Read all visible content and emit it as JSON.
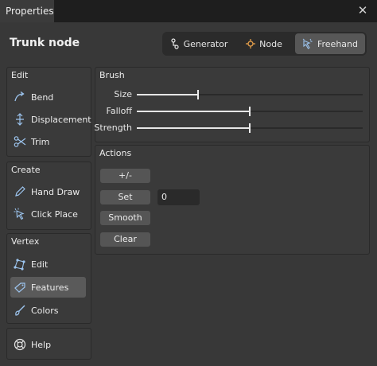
{
  "window": {
    "tab_title": "Properties",
    "close_label": "✕"
  },
  "header": {
    "title": "Trunk node"
  },
  "modes": [
    {
      "label": "Generator",
      "icon": "generator-icon",
      "active": false
    },
    {
      "label": "Node",
      "icon": "node-icon",
      "active": false
    },
    {
      "label": "Freehand",
      "icon": "freehand-icon",
      "active": true
    }
  ],
  "sidebar": {
    "edit": {
      "title": "Edit",
      "items": [
        {
          "label": "Bend",
          "icon": "bend-icon"
        },
        {
          "label": "Displacement",
          "icon": "displacement-icon"
        },
        {
          "label": "Trim",
          "icon": "scissors-icon"
        }
      ]
    },
    "create": {
      "title": "Create",
      "items": [
        {
          "label": "Hand Draw",
          "icon": "pencil-icon"
        },
        {
          "label": "Click Place",
          "icon": "click-place-icon"
        }
      ]
    },
    "vertex": {
      "title": "Vertex",
      "items": [
        {
          "label": "Edit",
          "icon": "vertex-edit-icon"
        },
        {
          "label": "Features",
          "icon": "features-icon",
          "selected": true
        },
        {
          "label": "Colors",
          "icon": "brush-icon"
        }
      ]
    },
    "help": {
      "label": "Help",
      "icon": "help-icon"
    }
  },
  "brush": {
    "title": "Brush",
    "sliders": [
      {
        "label": "Size",
        "value": 0.27
      },
      {
        "label": "Falloff",
        "value": 0.5
      },
      {
        "label": "Strength",
        "value": 0.5
      }
    ]
  },
  "actions": {
    "title": "Actions",
    "buttons": {
      "plus_minus": "+/-",
      "set": "Set",
      "smooth": "Smooth",
      "clear": "Clear"
    },
    "set_value": "0"
  },
  "colors": {
    "accent": "#7fb3e6",
    "icon": "#9cc4ee",
    "selected_bg": "#5a5a5a"
  }
}
